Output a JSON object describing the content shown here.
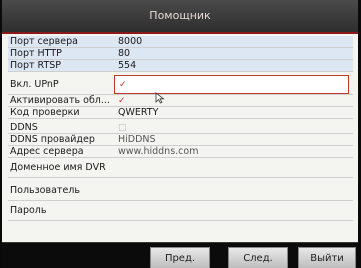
{
  "window": {
    "title": "Помощник"
  },
  "rows": [
    {
      "label": "Порт сервера",
      "value": "8000"
    },
    {
      "label": "Порт HTTP",
      "value": "80"
    },
    {
      "label": "Порт RTSP",
      "value": "554"
    },
    {
      "label": "Вкл. UPnP",
      "value": "✓"
    },
    {
      "label": "Активировать обл...",
      "value": "✓"
    },
    {
      "label": "Код проверки",
      "value": "QWERTY"
    },
    {
      "label": "DDNS",
      "value": "□"
    },
    {
      "label": "DDNS провайдер",
      "value": "HiDDNS"
    },
    {
      "label": "Адрес сервера",
      "value": "www.hiddns.com"
    },
    {
      "label": "Доменное имя DVR",
      "value": ""
    },
    {
      "label": "Пользователь",
      "value": ""
    },
    {
      "label": "Пароль",
      "value": ""
    }
  ],
  "buttons": {
    "prev": "Пред.",
    "next": "След.",
    "exit": "Выйти"
  }
}
